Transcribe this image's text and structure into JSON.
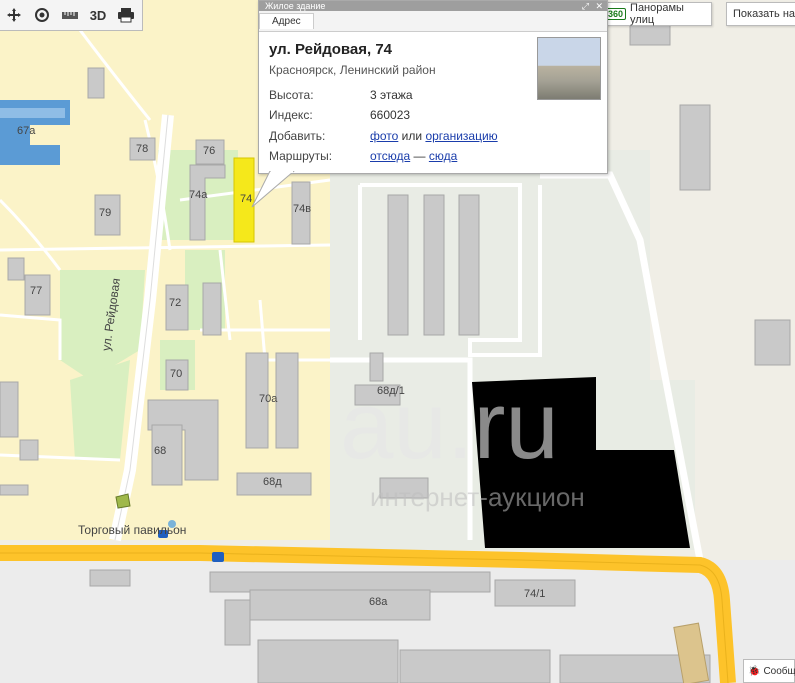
{
  "toolbar": {
    "three_d_label": "3D",
    "icons": [
      "move-icon",
      "target-icon",
      "ruler-icon",
      "3d-toggle",
      "print-icon"
    ]
  },
  "popup": {
    "header": "Жилое здание",
    "tab": "Адрес",
    "title": "ул. Рейдовая, 74",
    "subtitle": "Красноярск, Ленинский район",
    "rows": {
      "height_label": "Высота:",
      "height_value": "3 этажа",
      "index_label": "Индекс:",
      "index_value": "660023",
      "add_label": "Добавить:",
      "add_photo": "фото",
      "add_or": "или",
      "add_org": "организацию",
      "routes_label": "Маршруты:",
      "route_from": "отсюда",
      "route_dash": "—",
      "route_to": "сюда"
    }
  },
  "controls": {
    "panorama_badge": "360",
    "panorama_label": "Панорамы улиц",
    "show_label": "Показать на",
    "feedback_label": "Сообщ"
  },
  "map": {
    "street": "ул. Рейдовая",
    "pavilion": "Торговый павильон",
    "buildings": [
      "67а",
      "78",
      "76",
      "74а",
      "74",
      "74в",
      "79",
      "77",
      "72",
      "70",
      "70а",
      "68",
      "68д/1",
      "68д",
      "68а",
      "74/1"
    ],
    "highlight_color": "#f5e81b",
    "road_color": "#fdc32a"
  },
  "watermark": {
    "main": "au.ru",
    "sub": "интернет-аукцион"
  }
}
